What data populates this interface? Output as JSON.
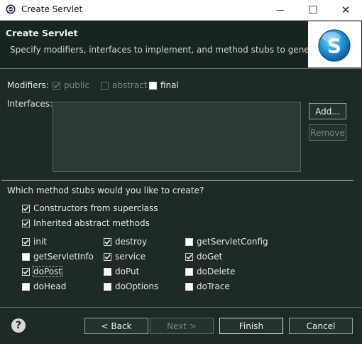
{
  "window": {
    "title": "Create Servlet",
    "minimize_glyph": "—",
    "maximize_glyph": "☐",
    "close_glyph": "✕"
  },
  "banner": {
    "heading": "Create Servlet",
    "description": "Specify modifiers, interfaces to implement, and method stubs to generate.",
    "logo_letter": "S"
  },
  "modifiers": {
    "label": "Modifiers:",
    "public": {
      "label": "public",
      "checked": true,
      "enabled": false
    },
    "abstract": {
      "label": "abstract",
      "checked": false,
      "enabled": false
    },
    "final": {
      "label": "final",
      "checked": false,
      "enabled": true
    }
  },
  "interfaces": {
    "label": "Interfaces:",
    "add_button": "Add...",
    "remove_button": "Remove"
  },
  "stubs": {
    "question": "Which method stubs would you like to create?",
    "constructors": {
      "label": "Constructors from superclass",
      "checked": true
    },
    "inherited": {
      "label": "Inherited abstract methods",
      "checked": true
    },
    "methods": [
      {
        "label": "init",
        "checked": true
      },
      {
        "label": "destroy",
        "checked": true
      },
      {
        "label": "getServletConfig",
        "checked": false
      },
      {
        "label": "getServletInfo",
        "checked": false
      },
      {
        "label": "service",
        "checked": true
      },
      {
        "label": "doGet",
        "checked": true
      },
      {
        "label": "doPost",
        "checked": true
      },
      {
        "label": "doPut",
        "checked": false
      },
      {
        "label": "doDelete",
        "checked": false
      },
      {
        "label": "doHead",
        "checked": false
      },
      {
        "label": "doOptions",
        "checked": false
      },
      {
        "label": "doTrace",
        "checked": false
      }
    ]
  },
  "footer": {
    "help_glyph": "?",
    "back_button": "< Back",
    "next_button": "Next >",
    "finish_button": "Finish",
    "cancel_button": "Cancel"
  },
  "colors": {
    "background": "#1e2b24",
    "banner": "#17261e",
    "logo_blue": "#1e90d6"
  }
}
